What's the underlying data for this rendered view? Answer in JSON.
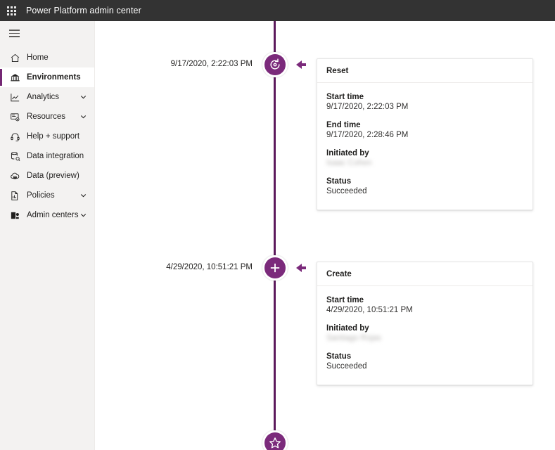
{
  "suite": {
    "app_launcher_name": "waffle-icon",
    "title": "Power Platform admin center"
  },
  "sidebar": {
    "menu_toggle_name": "hamburger-icon",
    "items": [
      {
        "label": "Home",
        "icon": "home-icon",
        "selected": false,
        "expandable": false
      },
      {
        "label": "Environments",
        "icon": "environments-icon",
        "selected": true,
        "expandable": false
      },
      {
        "label": "Analytics",
        "icon": "analytics-icon",
        "selected": false,
        "expandable": true
      },
      {
        "label": "Resources",
        "icon": "resources-icon",
        "selected": false,
        "expandable": true
      },
      {
        "label": "Help + support",
        "icon": "headset-icon",
        "selected": false,
        "expandable": false
      },
      {
        "label": "Data integration",
        "icon": "data-integration-icon",
        "selected": false,
        "expandable": false
      },
      {
        "label": "Data (preview)",
        "icon": "cloud-data-icon",
        "selected": false,
        "expandable": false
      },
      {
        "label": "Policies",
        "icon": "policies-icon",
        "selected": false,
        "expandable": true
      },
      {
        "label": "Admin centers",
        "icon": "admin-centers-icon",
        "selected": false,
        "expandable": true
      }
    ]
  },
  "colors": {
    "accent_purple": "#7b2a7b",
    "spine_purple": "#5c1a5c",
    "suitebar": "#333333",
    "nav_background": "#f3f2f1"
  },
  "timeline": {
    "events": [
      {
        "timestamp_label": "9/17/2020, 2:22:03 PM",
        "node_icon": "reset-icon",
        "card": {
          "title": "Reset",
          "fields": [
            {
              "key": "Start time",
              "value": "9/17/2020, 2:22:03 PM",
              "redacted": false
            },
            {
              "key": "End time",
              "value": "9/17/2020, 2:28:46 PM",
              "redacted": false
            },
            {
              "key": "Initiated by",
              "value": "Isaac Cohen",
              "redacted": true
            },
            {
              "key": "Status",
              "value": "Succeeded",
              "redacted": false
            }
          ]
        }
      },
      {
        "timestamp_label": "4/29/2020, 10:51:21 PM",
        "node_icon": "create-plus-icon",
        "card": {
          "title": "Create",
          "fields": [
            {
              "key": "Start time",
              "value": "4/29/2020, 10:51:21 PM",
              "redacted": false
            },
            {
              "key": "Initiated by",
              "value": "Santiago Rojas",
              "redacted": true
            },
            {
              "key": "Status",
              "value": "Succeeded",
              "redacted": false
            }
          ]
        }
      },
      {
        "timestamp_label": "",
        "node_icon": "star-icon",
        "card": null
      }
    ]
  }
}
